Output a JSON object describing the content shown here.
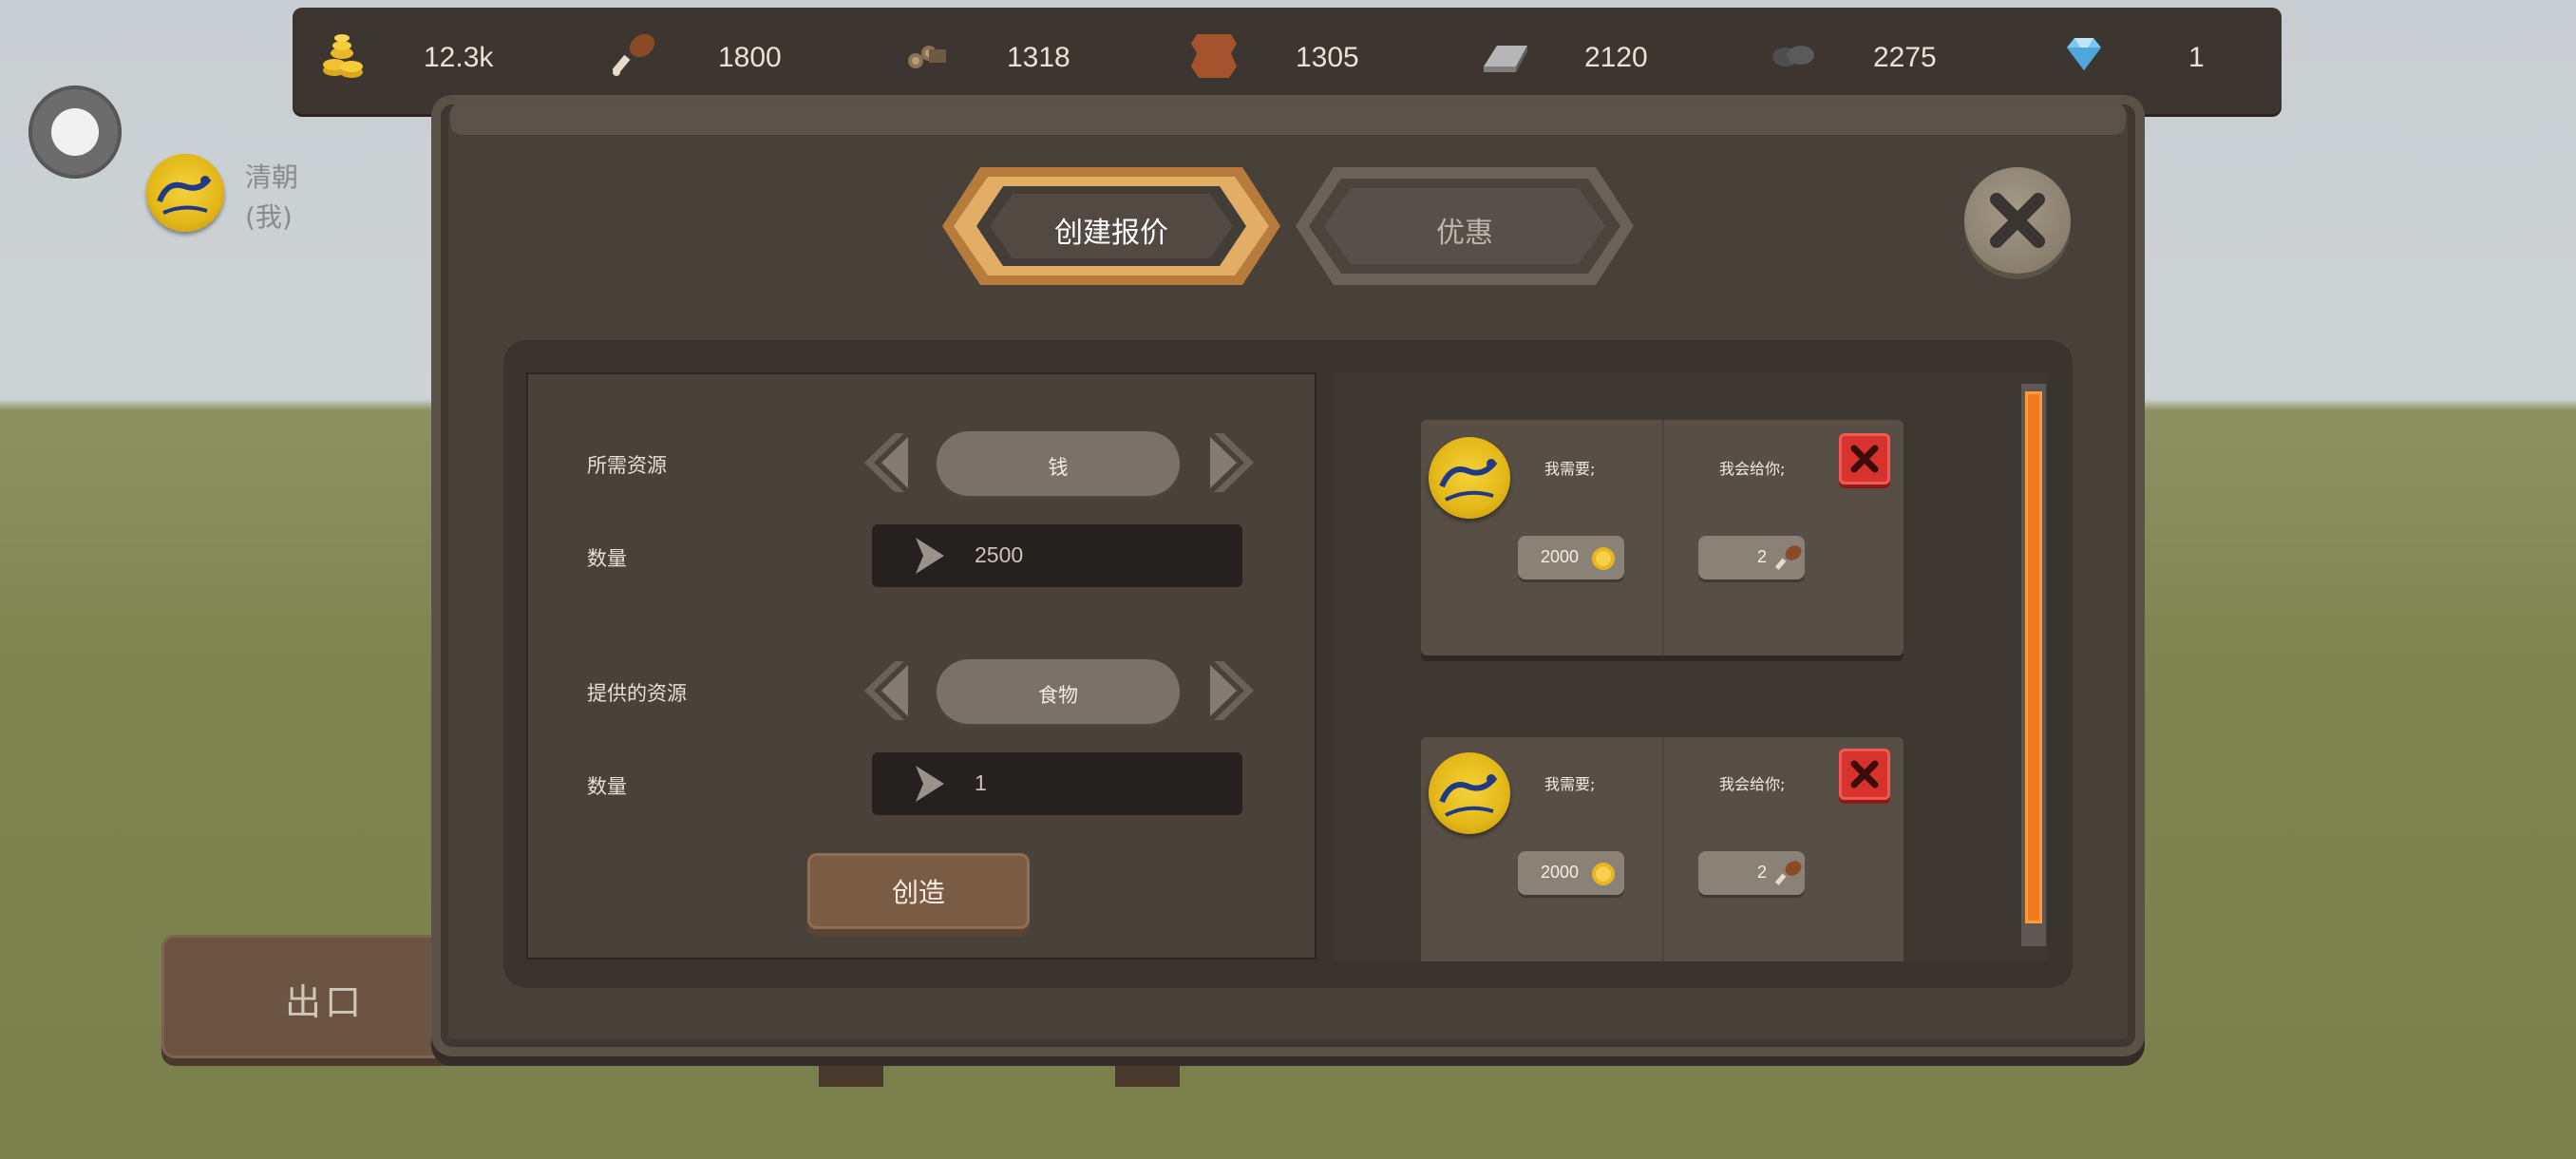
{
  "resources": [
    {
      "icon": "coins-icon",
      "value": "12.3k"
    },
    {
      "icon": "food-drumstick-icon",
      "value": "1800"
    },
    {
      "icon": "wood-logs-icon",
      "value": "1318"
    },
    {
      "icon": "leather-hide-icon",
      "value": "1305"
    },
    {
      "icon": "iron-ingot-icon",
      "value": "2120"
    },
    {
      "icon": "stone-icon",
      "value": "2275"
    },
    {
      "icon": "diamond-icon",
      "value": "1"
    }
  ],
  "player": {
    "name_line1": "清朝",
    "name_line2": "(我)"
  },
  "exit_label": "出口",
  "tabs": [
    {
      "label": "创建报价",
      "active": true
    },
    {
      "label": "优惠",
      "active": false
    }
  ],
  "form": {
    "required_label": "所需资源",
    "required_value": "钱",
    "qty1_label": "数量",
    "qty1_value": "2500",
    "offered_label": "提供的资源",
    "offered_value": "食物",
    "qty2_label": "数量",
    "qty2_value": "1",
    "create_label": "创造"
  },
  "offers": [
    {
      "need_label": "我需要;",
      "give_label": "我会给你;",
      "need_amount": "2000",
      "need_icon": "coin-icon",
      "give_amount": "2",
      "give_icon": "food-drumstick-icon"
    },
    {
      "need_label": "我需要;",
      "give_label": "我会给你;",
      "need_amount": "2000",
      "need_icon": "coin-icon",
      "give_amount": "2",
      "give_icon": "food-drumstick-icon"
    }
  ],
  "colors": {
    "accent_tab": "#d9a15a",
    "scrollbar": "#f07a1e",
    "delete": "#d8322c"
  }
}
